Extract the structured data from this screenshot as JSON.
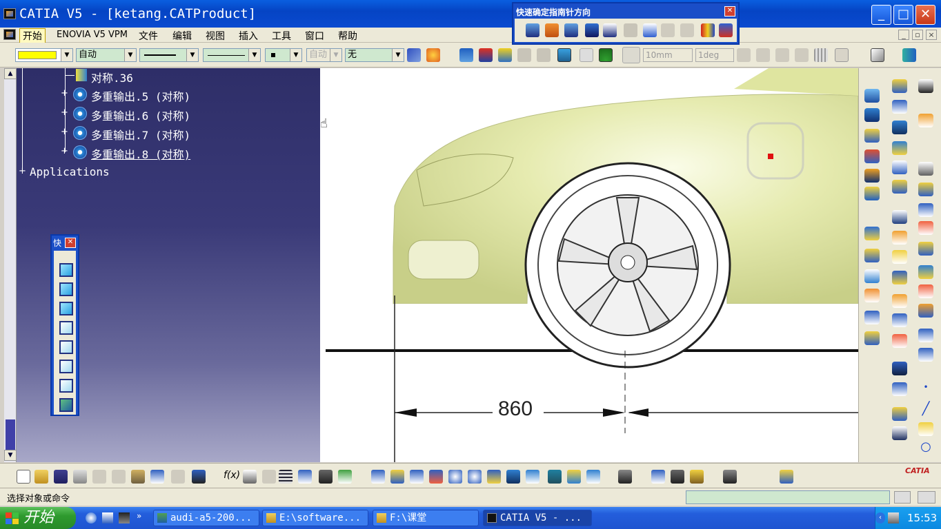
{
  "window": {
    "title": "CATIA V5 - [ketang.CATProduct]",
    "buttons": [
      "_",
      "□",
      "✕"
    ]
  },
  "menu": {
    "items": [
      "开始",
      "ENOVIA V5 VPM",
      "文件",
      "编辑",
      "视图",
      "插入",
      "工具",
      "窗口",
      "帮助"
    ]
  },
  "properties_toolbar": {
    "color_value": "",
    "weight_value": "自动",
    "linetype_value": "",
    "pointtype_value": "",
    "layer_value": "无",
    "disabled_combo": "自动",
    "length_step": "10mm",
    "angle_step": "1deg"
  },
  "quick_direction_toolbar": {
    "title": "快速确定指南针方向",
    "close": "✕"
  },
  "tree": {
    "items": [
      {
        "label": "对称.36",
        "underline": false
      },
      {
        "label": "多重输出.5 (对称)",
        "underline": false
      },
      {
        "label": "多重输出.6 (对称)",
        "underline": false
      },
      {
        "label": "多重输出.7 (对称)",
        "underline": false
      },
      {
        "label": "多重输出.8 (对称)",
        "underline": true
      }
    ],
    "applications": "Applications"
  },
  "quick_view_toolbar": {
    "title": "快",
    "close": "✕"
  },
  "drawing": {
    "dimension": "860"
  },
  "status": {
    "prompt": "选择对象或命令"
  },
  "taskbar": {
    "start": "开始",
    "tasks": [
      "audi-a5-200...",
      "E:\\software...",
      "F:\\课堂",
      "CATIA V5 - ..."
    ],
    "clock": "15:53"
  },
  "brand": {
    "logo": "CATIA"
  },
  "colors": {
    "title_bar": "#0a4ad0",
    "tree_background_top": "#2e2e68",
    "car_body": "#e6ebb0",
    "taskbar": "#245edc"
  }
}
